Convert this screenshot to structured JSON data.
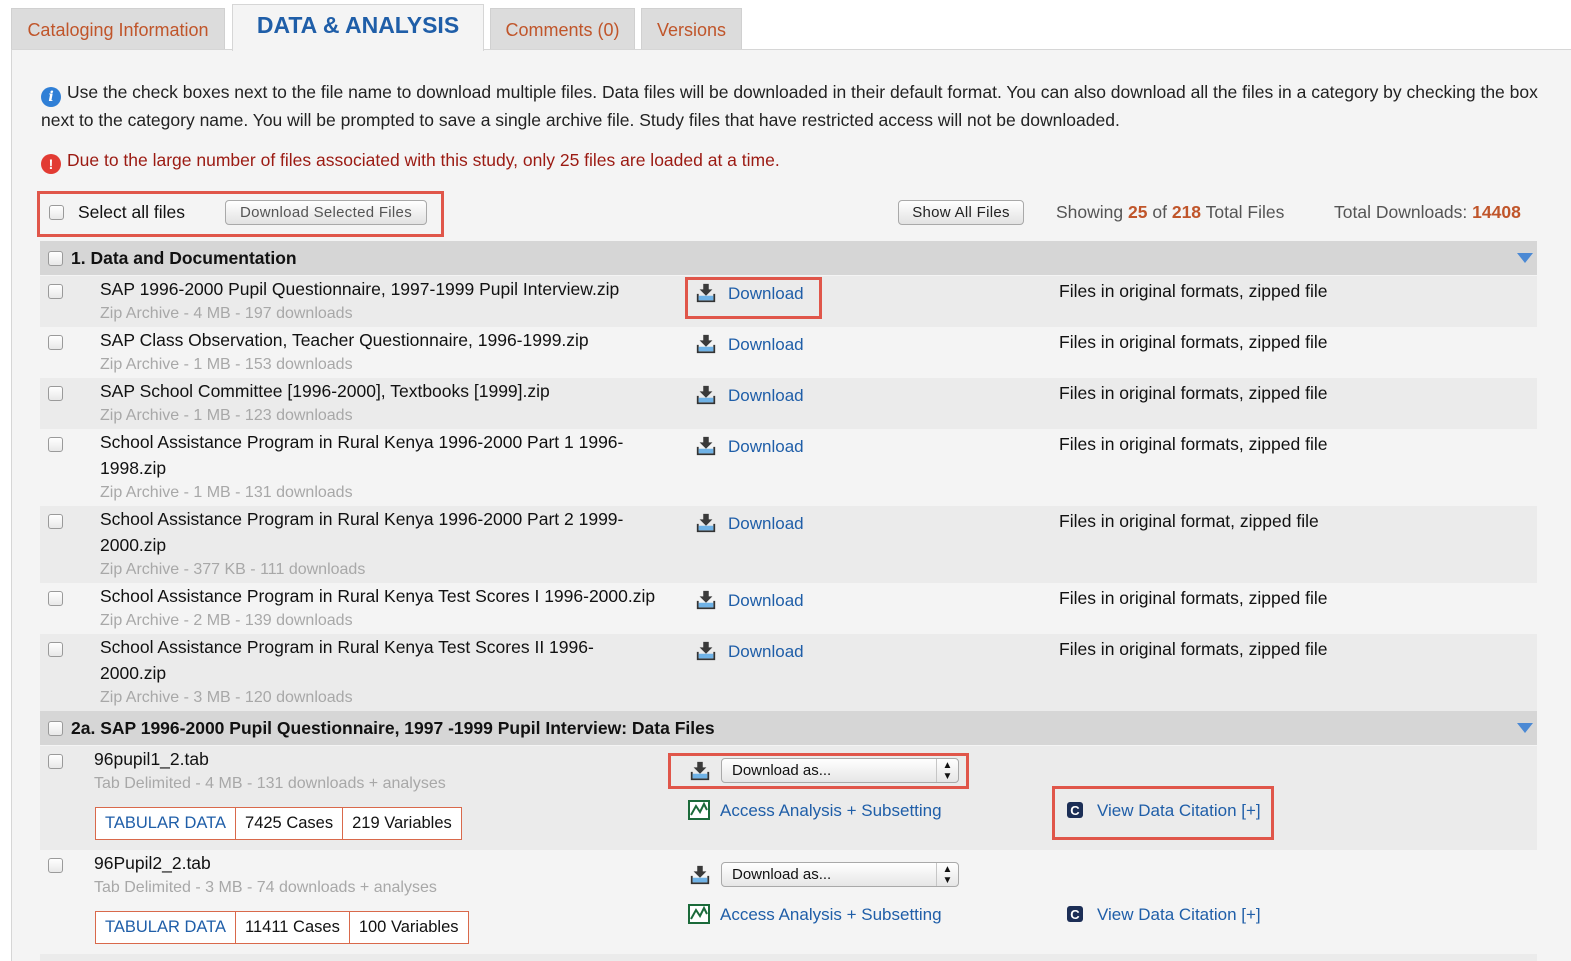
{
  "tabs": [
    {
      "label": "Cataloging Information"
    },
    {
      "label": "DATA & ANALYSIS"
    },
    {
      "label": "Comments (0)"
    },
    {
      "label": "Versions"
    }
  ],
  "info": {
    "text": "Use the check boxes next to the file name to download multiple files. Data files will be downloaded in their default format. You can also download all the files in a category by checking the box next to the category name. You will be prompted to save a single archive file. Study files that have restricted access will not be downloaded.",
    "warning": "Due to the large number of files associated with this study, only 25 files are loaded at a time."
  },
  "toolbar": {
    "select_all_label": "Select all files",
    "download_selected_label": "Download Selected Files",
    "show_all_label": "Show All Files",
    "showing_prefix": "Showing",
    "showing_count": "25",
    "showing_of": "of",
    "total_files": "218",
    "showing_suffix": "Total Files",
    "total_downloads_label": "Total Downloads:",
    "total_downloads": "14408"
  },
  "sections": [
    {
      "title": "1. Data and Documentation",
      "files": [
        {
          "name": "SAP 1996-2000 Pupil Questionnaire, 1997-1999 Pupil Interview.zip",
          "meta": "Zip Archive - 4 MB - 197 downloads",
          "link": "Download",
          "desc": "Files in original formats, zipped file"
        },
        {
          "name": "SAP Class Observation, Teacher Questionnaire, 1996-1999.zip",
          "meta": "Zip Archive - 1 MB - 153 downloads",
          "link": "Download",
          "desc": "Files in original formats, zipped file"
        },
        {
          "name": "SAP School Committee [1996-2000], Textbooks [1999].zip",
          "meta": "Zip Archive - 1 MB - 123 downloads",
          "link": "Download",
          "desc": "Files in original formats, zipped file"
        },
        {
          "name_line1": "School Assistance Program in Rural Kenya 1996-2000 Part 1 1996-",
          "name_line2": "1998.zip",
          "meta": "Zip Archive - 1 MB - 131 downloads",
          "link": "Download",
          "desc": "Files in original formats, zipped file"
        },
        {
          "name_line1": "School Assistance Program in Rural Kenya 1996-2000 Part 2 1999-",
          "name_line2": "2000.zip",
          "meta": "Zip Archive - 377 KB - 111 downloads",
          "link": "Download",
          "desc": "Files in original format, zipped file"
        },
        {
          "name": "School Assistance Program in Rural Kenya Test Scores I 1996-2000.zip",
          "meta": "Zip Archive - 2 MB - 139 downloads",
          "link": "Download",
          "desc": "Files in original formats, zipped file"
        },
        {
          "name_line1": "School Assistance Program in Rural Kenya Test Scores II 1996-",
          "name_line2": "2000.zip",
          "meta": "Zip Archive - 3 MB - 120 downloads",
          "link": "Download",
          "desc": "Files in original formats, zipped file"
        }
      ]
    },
    {
      "title": "2a. SAP 1996-2000 Pupil Questionnaire, 1997 -1999 Pupil Interview: Data Files",
      "files": [
        {
          "name": "96pupil1_2.tab",
          "meta": "Tab Delimited - 4 MB - 131 downloads + analyses",
          "select": "Download as...",
          "analysis": "Access Analysis + Subsetting",
          "citation": "View Data Citation [+]",
          "badge_type": "TABULAR DATA",
          "cases": "7425 Cases",
          "variables": "219 Variables"
        },
        {
          "name": "96Pupil2_2.tab",
          "meta": "Tab Delimited - 3 MB - 74 downloads + analyses",
          "select": "Download as...",
          "analysis": "Access Analysis + Subsetting",
          "citation": "View Data Citation [+]",
          "badge_type": "TABULAR DATA",
          "cases": "11411 Cases",
          "variables": "100 Variables"
        }
      ]
    }
  ],
  "colors": {
    "accent": "#c0552a",
    "link": "#1f5ea8",
    "highlight_box": "#e0564a"
  }
}
